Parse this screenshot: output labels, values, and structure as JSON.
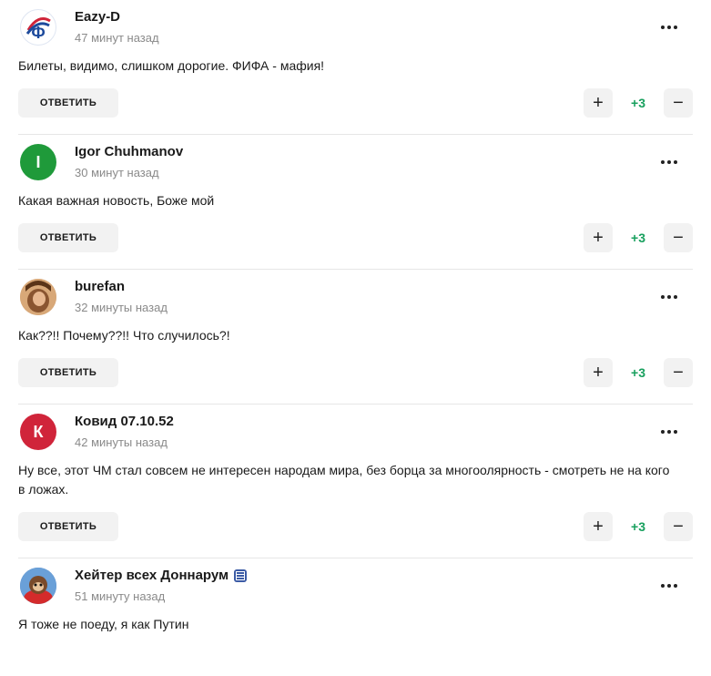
{
  "comments": [
    {
      "author": "Eazy-D",
      "time": "47 минут назад",
      "text": "Билеты, видимо, слишком дорогие. ФИФА - мафия!",
      "reply_label": "ОТВЕТИТЬ",
      "score": "+3",
      "avatar": {
        "type": "logo",
        "letter": "Ф",
        "color": "#1d4a9c"
      }
    },
    {
      "author": "Igor Chuhmanov",
      "time": "30 минут назад",
      "text": "Какая важная новость, Боже мой",
      "reply_label": "ОТВЕТИТЬ",
      "score": "+3",
      "avatar": {
        "type": "letter",
        "letter": "I",
        "color": "#1f9a3a"
      }
    },
    {
      "author": "burefan",
      "time": "32 минуты назад",
      "text": "Как??!! Почему??!! Что случилось?!",
      "reply_label": "ОТВЕТИТЬ",
      "score": "+3",
      "avatar": {
        "type": "photo",
        "color": "#9a6a44"
      }
    },
    {
      "author": "Ковид 07.10.52",
      "time": "42 минуты назад",
      "text": "Ну все, этот ЧМ стал совсем не интересен народам мира, без борца за многоолярность - смотреть не на кого в ложах.",
      "reply_label": "ОТВЕТИТЬ",
      "score": "+3",
      "avatar": {
        "type": "letter",
        "letter": "К",
        "color": "#d0243a"
      }
    },
    {
      "author": "Хейтер всех Доннарум",
      "time": "51 минуту назад",
      "text": "Я тоже не поеду, я как Путин",
      "reply_label": "",
      "score": "",
      "avatar": {
        "type": "photo",
        "color": "#3d72b8"
      },
      "badge_icon": "club-badge-icon"
    }
  ],
  "icons": {
    "more": "more-dots-icon",
    "plus": "plus-icon",
    "minus": "minus-icon"
  },
  "colors": {
    "score": "#18a05e",
    "button_bg": "#f2f2f2",
    "meta": "#8a8a8a"
  }
}
